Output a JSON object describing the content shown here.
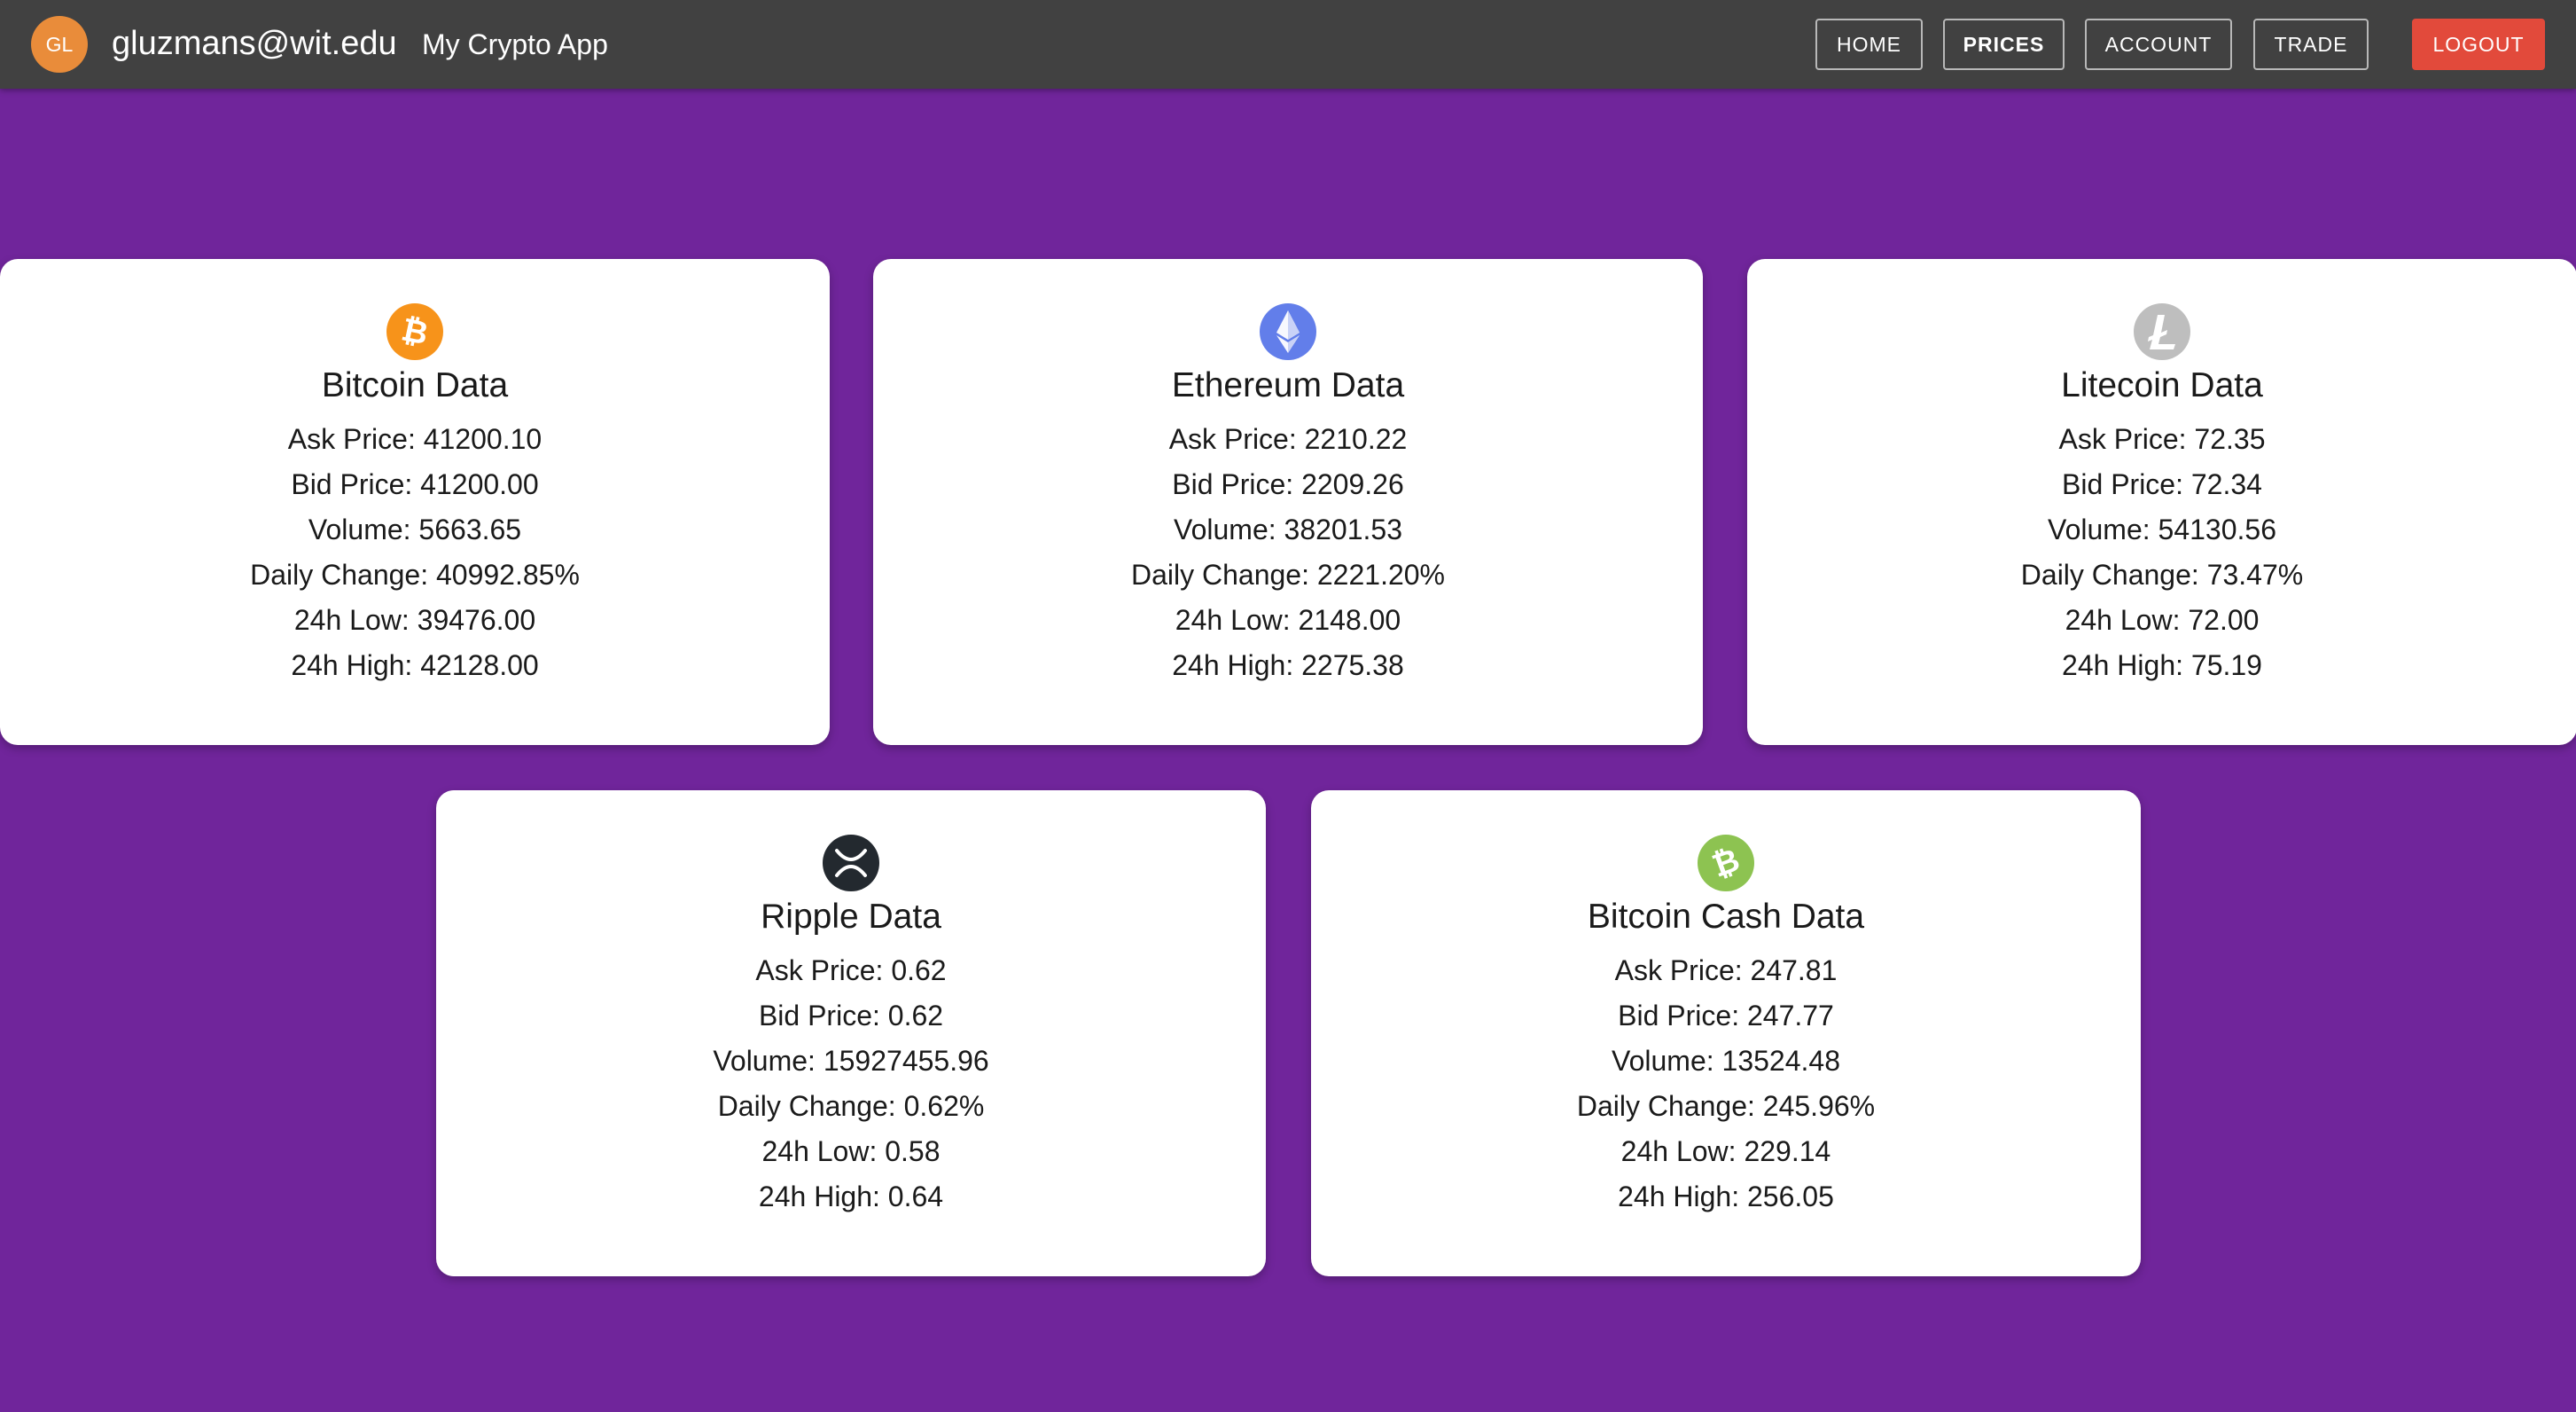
{
  "header": {
    "avatar_initials": "GL",
    "user_email": "gluzmans@wit.edu",
    "app_title": "My Crypto App",
    "nav": {
      "home": "HOME",
      "prices": "PRICES",
      "account": "ACCOUNT",
      "trade": "TRADE",
      "logout": "LOGOUT"
    },
    "active_tab": "PRICES"
  },
  "colors": {
    "background": "#70259b",
    "topbar": "#414141",
    "avatar": "#e98c3a",
    "logout": "#e24a3b",
    "bitcoin": "#f7931a",
    "ethereum": "#627eea",
    "litecoin": "#bebebe",
    "ripple": "#23292f",
    "bitcoin_cash": "#8dc351"
  },
  "cards": [
    {
      "icon": "bitcoin-icon",
      "title": "Bitcoin Data",
      "ask": "Ask Price: 41200.10",
      "bid": "Bid Price: 41200.00",
      "volume": "Volume: 5663.65",
      "change": "Daily Change: 40992.85%",
      "low": "24h Low: 39476.00",
      "high": "24h High: 42128.00"
    },
    {
      "icon": "ethereum-icon",
      "title": "Ethereum Data",
      "ask": "Ask Price: 2210.22",
      "bid": "Bid Price: 2209.26",
      "volume": "Volume: 38201.53",
      "change": "Daily Change: 2221.20%",
      "low": "24h Low: 2148.00",
      "high": "24h High: 2275.38"
    },
    {
      "icon": "litecoin-icon",
      "title": "Litecoin Data",
      "ask": "Ask Price: 72.35",
      "bid": "Bid Price: 72.34",
      "volume": "Volume: 54130.56",
      "change": "Daily Change: 73.47%",
      "low": "24h Low: 72.00",
      "high": "24h High: 75.19"
    },
    {
      "icon": "ripple-icon",
      "title": "Ripple Data",
      "ask": "Ask Price: 0.62",
      "bid": "Bid Price: 0.62",
      "volume": "Volume: 15927455.96",
      "change": "Daily Change: 0.62%",
      "low": "24h Low: 0.58",
      "high": "24h High: 0.64"
    },
    {
      "icon": "bitcoin-cash-icon",
      "title": "Bitcoin Cash Data",
      "ask": "Ask Price: 247.81",
      "bid": "Bid Price: 247.77",
      "volume": "Volume: 13524.48",
      "change": "Daily Change: 245.96%",
      "low": "24h Low: 229.14",
      "high": "24h High: 256.05"
    }
  ]
}
